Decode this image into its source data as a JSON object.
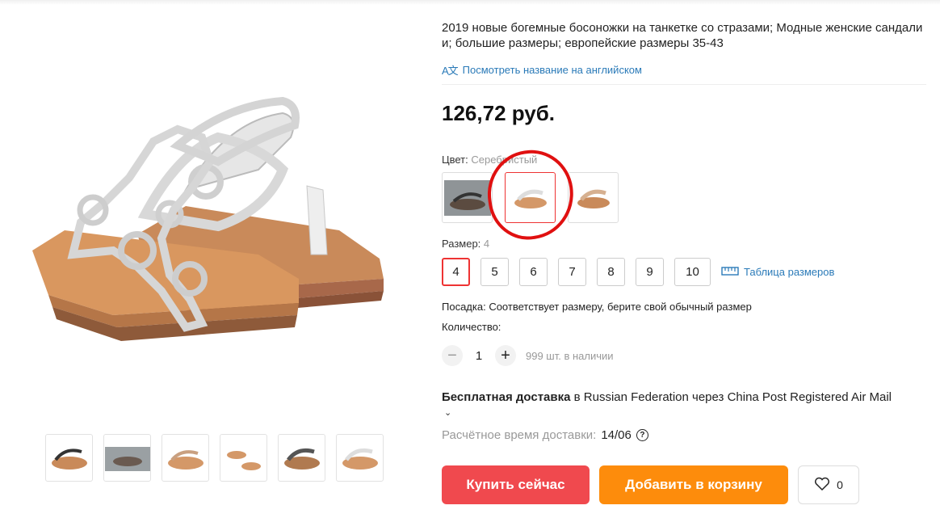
{
  "product": {
    "title": "2019 новые богемные босоножки на танкетке со стразами; Модные женские сандалии; большие размеры; европейские размеры 35-43",
    "translate_link": "Посмотреть название на английском",
    "translate_icon": "translate-icon",
    "price": "126,72 руб."
  },
  "color": {
    "label": "Цвет:",
    "value": "Серебристый",
    "options": [
      "black-sandal",
      "silver-sandal",
      "beige-sandal"
    ],
    "selected_index": 1
  },
  "size": {
    "label": "Размер:",
    "value": "4",
    "options": [
      "4",
      "5",
      "6",
      "7",
      "8",
      "9",
      "10"
    ],
    "selected": "4",
    "size_table_link": "Таблица размеров"
  },
  "fit": "Посадка: Соответствует размеру, берите свой обычный размер",
  "quantity": {
    "label": "Количество:",
    "value": "1",
    "stock": "999 шт. в наличии"
  },
  "shipping": {
    "free": "Бесплатная доставка",
    "rest": " в Russian Federation через China Post Registered Air Mail",
    "eta_label": "Расчётное время доставки:",
    "eta_date": "14/06"
  },
  "actions": {
    "buy_now": "Купить сейчас",
    "add_to_cart": "Добавить в корзину",
    "wishlist_count": "0"
  },
  "colors": {
    "buy": "#f0494e",
    "cart": "#fd8c0c",
    "link": "#2a7ab8",
    "selected": "#e33333",
    "annotation": "#e01010"
  }
}
